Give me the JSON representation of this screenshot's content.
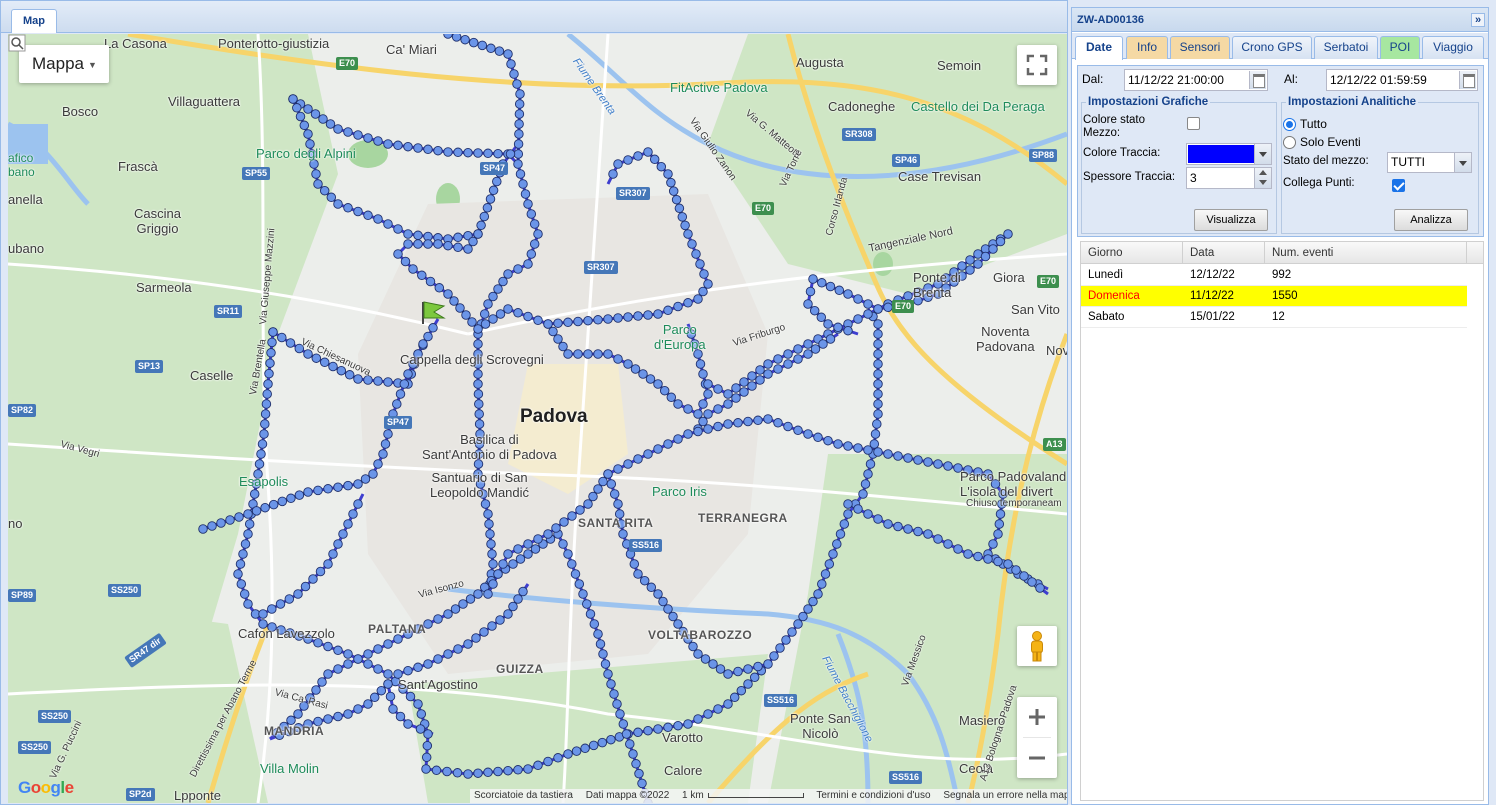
{
  "left_panel": {
    "tab_label": "Map"
  },
  "map": {
    "map_type_label": "Mappa",
    "labels": {
      "padova": "Padova",
      "la_casona": "La Casona",
      "ponterotto": "Ponterotto-giustizia",
      "ca_miari": "Ca' Miari",
      "bosco": "Bosco",
      "villaguattera": "Villaguattera",
      "frasca": "Frascà",
      "cascina_griggio": "Cascina\nGriggio",
      "anella": "anella",
      "ubano": "ubano",
      "sarmeola": "Sarmeola",
      "caselle": "Caselle",
      "no": "no",
      "fico_bano": "afico\nbano",
      "parco_alpini": "Parco degli Alpini",
      "fitactive": "FitActive Padova",
      "augusta": "Augusta",
      "semoin": "Semoin",
      "cadoneghe": "Cadoneghe",
      "castello": "Castello dei Da Peraga",
      "case_trevisan": "Case Trevisan",
      "tangenziale_nord": "Tangenziale Nord",
      "ponte_brenta": "Ponte di\nBrenta",
      "giora": "Giora",
      "san_vito": "San Vito",
      "noventa": "Noventa\nPadovana",
      "nov": "Nov",
      "parco_europa": "Parco\nd'Europa",
      "cappella": "Cappella degli Scrovegni",
      "basilica": "Basilica di\nSant'Antonio di Padova",
      "santuario": "Santuario di San\nLeopoldo Mandić",
      "santa_rita": "SANTA RITA",
      "parco_iris": "Parco Iris",
      "terranegra": "TERRANEGRA",
      "esapolis": "Esapolis",
      "paltana": "PALTANA",
      "guizza": "GUIZZA",
      "voltabarozzo": "VOLTABAROZZO",
      "caf_lavezzolo": "Cafon Lavezzolo",
      "sant_agostino": "Sant'Agostino",
      "mandria": "MANDRIA",
      "villa_molin": "Villa Molin",
      "ponte_san_nicolo": "Ponte San\nNicolò",
      "varotto": "Varotto",
      "calore": "Calore",
      "masiero": "Masiero",
      "ceola": "Ceola",
      "lpponte": "Lpponte",
      "parco_padovaland": "Parco Padovaland\nL'isola del divert",
      "chiuso": "Chiuso temporaneam",
      "fiume_brenta": "Fiume Brenta",
      "fiume_bacchiglione": "Fiume Bacchiglione",
      "via_friburgo": "Via Friburgo",
      "via_giulio_zanon": "Via Giulio Zanon",
      "via_g_matteotti": "Via G. Matteotti",
      "via_torre": "Via Torre",
      "corso_irlanda": "Corso Irlanda",
      "via_isonzo": "Via Isonzo",
      "via_chiesanuova": "Via Chiesanuova",
      "via_messico": "Via Messico",
      "via_ca_rasi": "Via Ca' Rasi",
      "via_g_puccini": "Via G. Puccini",
      "via_brentella": "Via Brentella",
      "via_giuseppe_mazzini": "Via Giuseppe Mazzini",
      "via_vegri": "Via Vegri",
      "direttissima": "Direttissima per Abano Terme",
      "a13_bologna": "A13 Bologna - Padova"
    },
    "road_shields": {
      "e70_top": "E70",
      "sp55": "SP55",
      "sp47_top": "SP47",
      "sr307": "SR307",
      "sr307b": "SR307",
      "sr308": "SR308",
      "sp46": "SP46",
      "sp88": "SP88",
      "e70_mid": "E70",
      "e70_right": "E70",
      "sr11": "SR11",
      "sp13": "SP13",
      "sp82": "SP82",
      "sp47_mid": "SP47",
      "ss516": "SS516",
      "ss516b": "SS516",
      "ss516c": "SS516",
      "a13": "A13",
      "sp89": "SP89",
      "ss250": "SS250",
      "ss250b": "SS250",
      "ss250c": "SS250",
      "sr47": "SR47 dir",
      "sp2d": "SP2d",
      "e70_b": "E70"
    },
    "google_logo": "Google",
    "footer": {
      "shortcuts": "Scorciatoie da tastiera",
      "map_data": "Dati mappa ©2022",
      "scale": "1 km",
      "terms": "Termini e condizioni d'uso",
      "report": "Segnala un errore nella mappa"
    },
    "track_color": "#3e3ecf",
    "point_color": "#6b95e8"
  },
  "right_panel": {
    "title": "ZW-AD00136",
    "tabs": [
      {
        "label": "Date",
        "style": "active"
      },
      {
        "label": "Info",
        "style": "orange"
      },
      {
        "label": "Sensori",
        "style": "orange"
      },
      {
        "label": "Crono GPS",
        "style": "normal"
      },
      {
        "label": "Serbatoi",
        "style": "normal"
      },
      {
        "label": "POI",
        "style": "green"
      },
      {
        "label": "Viaggio",
        "style": "normal"
      }
    ],
    "from_label": "Dal:",
    "from_value": "11/12/22 21:00:00",
    "to_label": "Al:",
    "to_value": "12/12/22 01:59:59",
    "graphic_settings": {
      "legend": "Impostazioni Grafiche",
      "vehicle_state_color_label": "Colore stato\nMezzo:",
      "vehicle_state_color_checked": false,
      "track_color_label": "Colore Traccia:",
      "track_color_value": "#0000ff",
      "track_thickness_label": "Spessore Traccia:",
      "track_thickness_value": "3",
      "visualize_button": "Visualizza"
    },
    "analytic_settings": {
      "legend": "Impostazioni Analitiche",
      "option_all": "Tutto",
      "option_events": "Solo Eventi",
      "selected": "Tutto",
      "vehicle_state_label": "Stato del mezzo:",
      "vehicle_state_value": "TUTTI",
      "connect_points_label": "Collega Punti:",
      "connect_points_checked": true,
      "analyze_button": "Analizza"
    },
    "table": {
      "columns": [
        "Giorno",
        "Data",
        "Num. eventi"
      ],
      "rows": [
        {
          "day": "Lunedì",
          "date": "12/12/22",
          "events": "992",
          "highlight": false
        },
        {
          "day": "Domenica",
          "date": "11/12/22",
          "events": "1550",
          "highlight": true
        },
        {
          "day": "Sabato",
          "date": "15/01/22",
          "events": "12",
          "highlight": false
        }
      ]
    }
  }
}
